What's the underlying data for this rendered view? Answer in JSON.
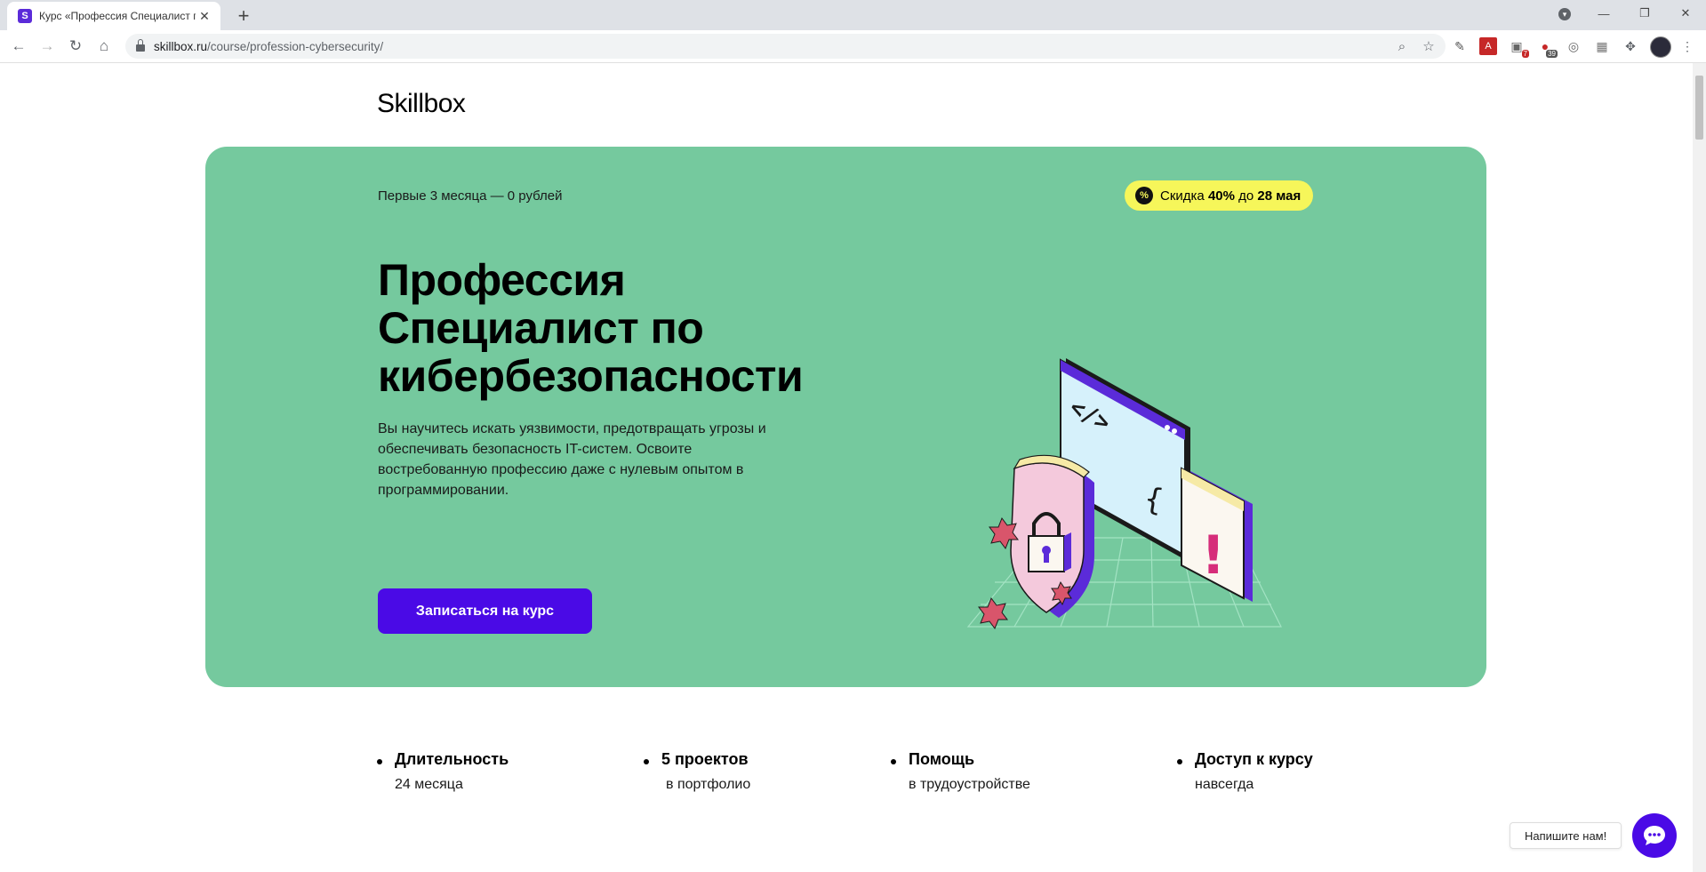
{
  "browser": {
    "tab_title": "Курс «Профессия Специалист п",
    "tab_favicon": "S",
    "url_domain": "skillbox.ru",
    "url_path": "/course/profession-cybersecurity/",
    "extension_badges": [
      "7",
      "39"
    ]
  },
  "site": {
    "logo": "Skillbox"
  },
  "hero": {
    "promo_text": "Первые 3 месяца — 0 рублей",
    "discount": {
      "icon": "%",
      "prefix": "Скидка",
      "amount": "40%",
      "middle": "до",
      "date": "28 мая"
    },
    "title": "Профессия Специалист по кибербезопасности",
    "description": "Вы научитесь искать уязвимости, предотвращать угрозы и обеспечивать безопасность IT-систем. Освоите востребованную профессию даже с нулевым опытом в программировании.",
    "cta_label": "Записаться на курс",
    "illustration_labels": {
      "code_tag": "</>",
      "braces": "{ }",
      "exclaim": "!"
    }
  },
  "features": [
    {
      "title": "Длительность",
      "subtitle": "24 месяца"
    },
    {
      "title": "5 проектов",
      "subtitle": "в портфолио"
    },
    {
      "title": "Помощь",
      "subtitle": "в трудоустройстве"
    },
    {
      "title": "Доступ к курсу",
      "subtitle": "навсегда"
    }
  ],
  "chat": {
    "label": "Напишите нам!"
  },
  "colors": {
    "hero_bg": "#75c99e",
    "accent": "#4a0ae6",
    "discount_bg": "#f6f65a"
  }
}
